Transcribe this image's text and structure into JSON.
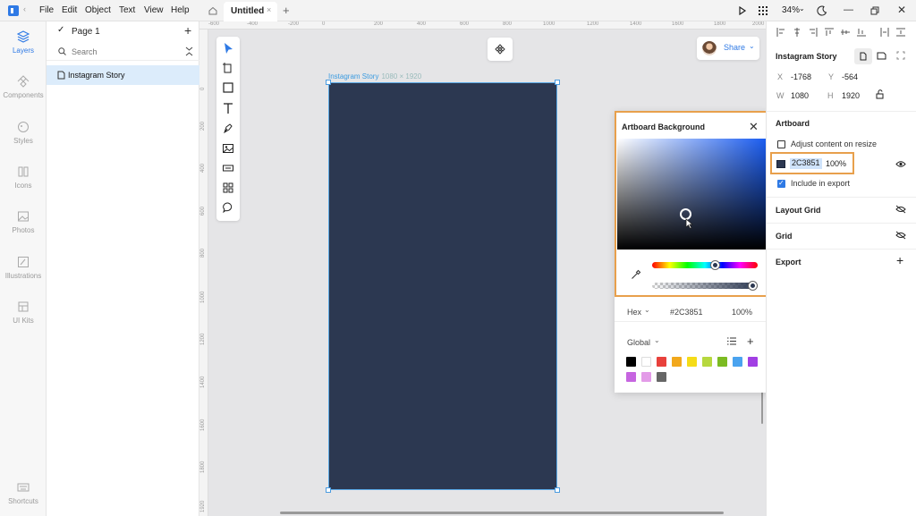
{
  "menu": {
    "items": [
      "File",
      "Edit",
      "Object",
      "Text",
      "View",
      "Help"
    ]
  },
  "tab": {
    "title": "Untitled",
    "close": "×",
    "add": "+"
  },
  "zoom": "34%",
  "rail": {
    "items": [
      {
        "label": "Layers",
        "icon": "layers-icon",
        "active": true
      },
      {
        "label": "Components",
        "icon": "components-icon"
      },
      {
        "label": "Styles",
        "icon": "styles-icon"
      },
      {
        "label": "Icons",
        "icon": "icons-icon"
      },
      {
        "label": "Photos",
        "icon": "photos-icon"
      },
      {
        "label": "Illustrations",
        "icon": "illustrations-icon"
      },
      {
        "label": "UI Kits",
        "icon": "ui-kits-icon"
      }
    ],
    "shortcuts": "Shortcuts"
  },
  "layers": {
    "page": "Page 1",
    "search_placeholder": "Search",
    "items": [
      "Instagram Story"
    ]
  },
  "canvas": {
    "ruler_top": [
      "-600",
      "-400",
      "-200",
      "0",
      "200",
      "400",
      "600",
      "800",
      "1000",
      "1200",
      "1400",
      "1600",
      "1800",
      "2000"
    ],
    "ruler_left": [
      "0",
      "200",
      "400",
      "600",
      "800",
      "1000",
      "1200",
      "1400",
      "1600",
      "1800",
      "1920"
    ],
    "artboard_name": "Instagram Story",
    "artboard_size": "1080 × 1920",
    "artboard_color": "#2C3851",
    "share": "Share"
  },
  "picker": {
    "title": "Artboard Background",
    "mode": "Hex",
    "hex": "#2C3851",
    "alpha": "100%",
    "palette_label": "Global",
    "swatches": [
      "#000000",
      "#ffffff",
      "#e8413c",
      "#f2a81c",
      "#f5dc18",
      "#b6d83e",
      "#7cbb22",
      "#4aa3ef",
      "#a13fe3",
      "#c665e0",
      "#e39be8",
      "#666666"
    ]
  },
  "inspector": {
    "title": "Instagram Story",
    "x_label": "X",
    "x": "-1768",
    "y_label": "Y",
    "y": "-564",
    "w_label": "W",
    "w": "1080",
    "h_label": "H",
    "h": "1920",
    "artboard_section": "Artboard",
    "adjust_label": "Adjust content on resize",
    "fill_hex": "2C3851",
    "fill_alpha": "100%",
    "include_export": "Include in export",
    "layout_grid": "Layout Grid",
    "grid": "Grid",
    "export": "Export"
  }
}
